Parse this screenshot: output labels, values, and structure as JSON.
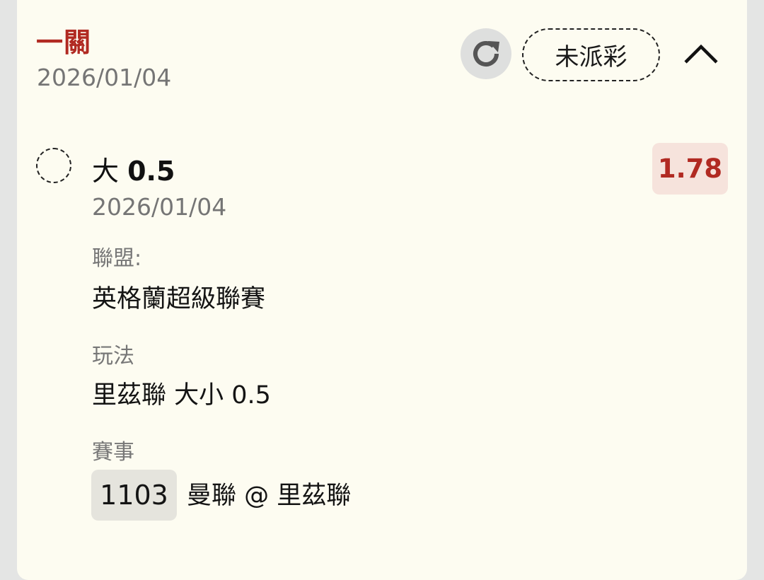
{
  "header": {
    "title": "一關",
    "date": "2026/01/04",
    "status_label": "未派彩"
  },
  "selection": {
    "pick": "大",
    "line": "0.5",
    "date": "2026/01/04",
    "odds": "1.78"
  },
  "details": {
    "league_label": "聯盟:",
    "league_value": "英格蘭超級聯賽",
    "bet_type_label": "玩法",
    "bet_type_value": "里茲聯 大小 0.5",
    "match_label": "賽事",
    "match_code": "1103",
    "match_name": "曼聯 @ 里茲聯"
  },
  "colors": {
    "accent": "#b12a22",
    "card_background": "#fdfcf1",
    "odds_background": "#f6e3dc",
    "page_background": "#e4e5e4"
  },
  "icons": {
    "refresh": "refresh-icon",
    "collapse": "chevron-up-icon",
    "radio": "radio-unselected-icon"
  }
}
